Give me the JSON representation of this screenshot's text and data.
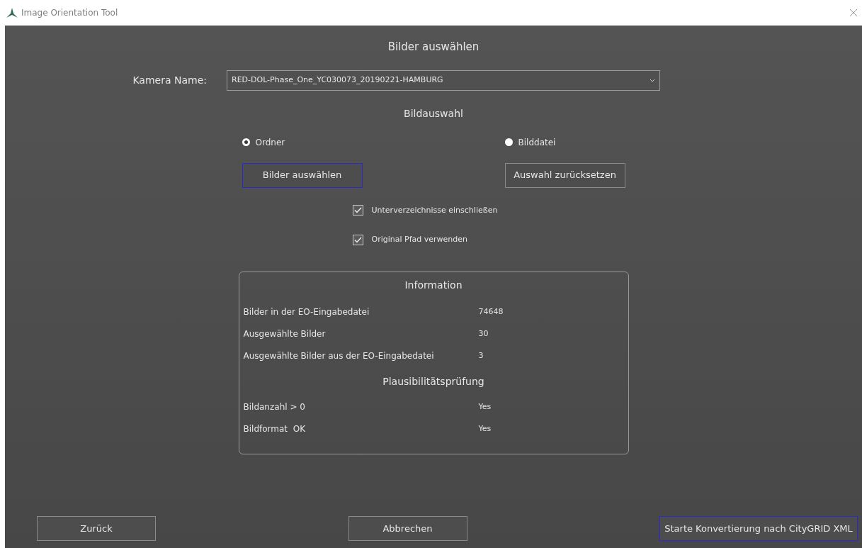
{
  "window": {
    "title": "Image Orientation Tool"
  },
  "heading": "Bilder auswählen",
  "camera": {
    "label": "Kamera Name:",
    "value": "RED-DOL-Phase_One_YC030073_20190221-HAMBURG"
  },
  "selection_heading": "Bildauswahl",
  "radios": [
    {
      "label": "Ordner",
      "selected": true
    },
    {
      "label": "Bilddatei",
      "selected": false
    }
  ],
  "selection_buttons": [
    {
      "label": "Bilder auswählen",
      "focused": true
    },
    {
      "label": "Auswahl zurücksetzen",
      "focused": false
    }
  ],
  "checkboxes": [
    {
      "label": "Unterverzeichnisse einschließen",
      "checked": true
    },
    {
      "label": "Original Pfad verwenden",
      "checked": true
    }
  ],
  "information": {
    "title": "Information",
    "rows": [
      {
        "label": "Bilder in der EO-Eingabedatei",
        "value": "74648"
      },
      {
        "label": "Ausgewählte Bilder",
        "value": "30"
      },
      {
        "label": "Ausgewählte Bilder aus der EO-Eingabedatei",
        "value": "3"
      }
    ],
    "check_title": "Plausibilitätsprüfung",
    "checks": [
      {
        "label": "Bildanzahl > 0",
        "value": "Yes"
      },
      {
        "label": "Bildformat  OK",
        "value": "Yes"
      }
    ]
  },
  "footer_buttons": [
    {
      "label": "Zurück",
      "focused": false
    },
    {
      "label": "Abbrechen",
      "focused": false
    },
    {
      "label": "Starte Konvertierung nach CityGRID XML",
      "focused": true
    }
  ]
}
